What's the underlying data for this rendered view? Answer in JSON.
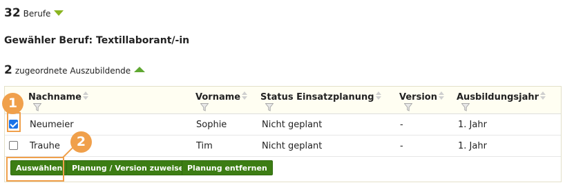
{
  "summary": {
    "berufe_count": "32",
    "berufe_label": "Berufe",
    "selected_heading": "Gewähler Beruf: Textillaborant/-in",
    "trainees_count": "2",
    "trainees_label": "zugeordnete Auszubildende"
  },
  "table": {
    "columns": [
      "Nachname",
      "Vorname",
      "Status Einsatzplanung",
      "Version",
      "Ausbildungsjahr"
    ],
    "rows": [
      {
        "checked": true,
        "nachname": "Neumeier",
        "vorname": "Sophie",
        "status": "Nicht geplant",
        "version": "-",
        "jahr": "1. Jahr"
      },
      {
        "checked": false,
        "nachname": "Trauhe",
        "vorname": "Tim",
        "status": "Nicht geplant",
        "version": "-",
        "jahr": "1. Jahr"
      }
    ]
  },
  "actions": {
    "select": "Auswählen",
    "assign": "Planung / Version zuweisen",
    "remove": "Planung entfernen"
  },
  "callouts": {
    "one": "1",
    "two": "2"
  },
  "colors": {
    "button_green": "#3c7d14",
    "callout_orange": "#f0a04b",
    "header_bg": "#fffef2",
    "checkbox_blue": "#1a73e8"
  },
  "icons": [
    "collapse-arrow-icon",
    "expand-arrow-icon",
    "sort-icon",
    "filter-icon",
    "checkbox-icon"
  ]
}
